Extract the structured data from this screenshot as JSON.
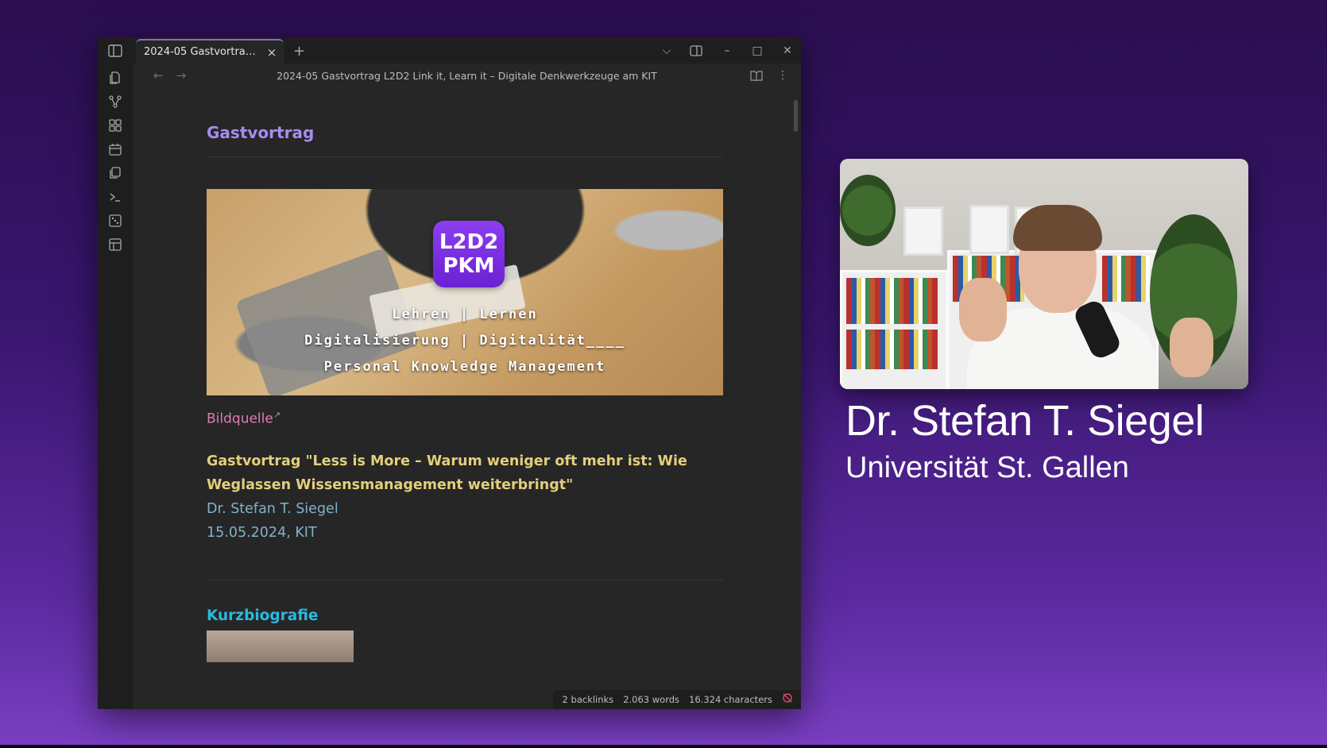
{
  "window": {
    "tab_title": "2024-05 Gastvortrag L...",
    "tab_close": "×",
    "new_tab": "+",
    "controls": {
      "dropdown": "⌵",
      "minimize": "–",
      "maximize": "□",
      "close": "✕"
    }
  },
  "navbar": {
    "back": "←",
    "forward": "→",
    "note_title": "2024-05 Gastvortrag L2D2 Link it, Learn it – Digitale Denkwerkzeuge am KIT",
    "more": "⋮"
  },
  "ribbon": {
    "icons": [
      "files-icon",
      "graph-icon",
      "canvas-icon",
      "calendar-icon",
      "templates-icon",
      "terminal-icon",
      "random-note-icon",
      "layout-icon"
    ]
  },
  "document": {
    "heading": "Gastvortrag",
    "banner": {
      "logo_line1": "L2D2",
      "logo_line2": "PKM",
      "line1": "Lehren | Lernen",
      "line2": "Digitalisierung | Digitalität____",
      "line3": "Personal Knowledge Management"
    },
    "image_source_link": "Bildquelle",
    "talk_title": "Gastvortrag \"Less is More – Warum weniger oft mehr ist: Wie Weglassen Wissensmanagement weiterbringt\"",
    "talk_author": "Dr. Stefan T. Siegel",
    "talk_date": "15.05.2024, KIT",
    "section_heading": "Kurzbiografie"
  },
  "statusbar": {
    "backlinks": "2 backlinks",
    "words": "2.063 words",
    "characters": "16.324 characters"
  },
  "overlay": {
    "speaker_name": "Dr. Stefan T. Siegel",
    "speaker_affiliation": "Universität St. Gallen"
  },
  "colors": {
    "accent": "#7c6fcf",
    "heading_purple": "#a58cf0",
    "link_pink": "#e07bb4",
    "talk_yellow": "#e3cf7a",
    "author_blue": "#7fb3c9",
    "heading_cyan": "#2bb9df",
    "background_purple": "#3a1670"
  }
}
